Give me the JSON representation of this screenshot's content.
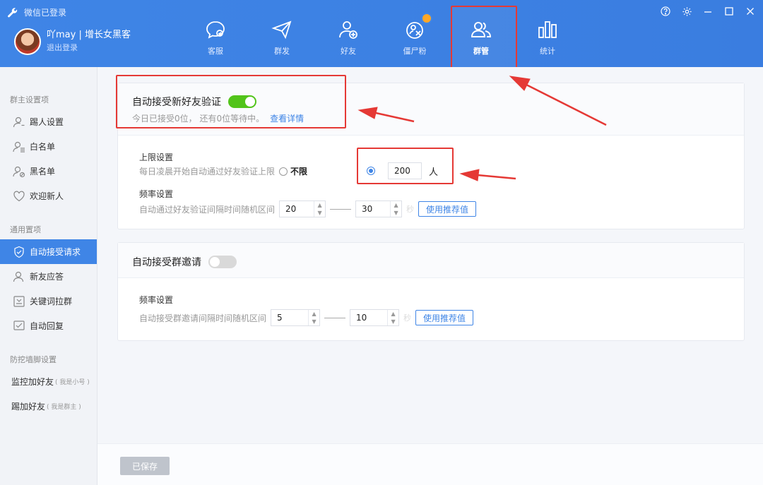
{
  "header": {
    "status": "微信已登录",
    "user_name": "吖may | 增长女黑客",
    "logout": "退出登录",
    "nav": [
      {
        "label": "客服",
        "icon": "chat-icon"
      },
      {
        "label": "群发",
        "icon": "send-icon"
      },
      {
        "label": "好友",
        "icon": "add-friend-icon"
      },
      {
        "label": "僵尸粉",
        "icon": "zombie-fan-icon"
      },
      {
        "label": "群管",
        "icon": "group-manage-icon"
      },
      {
        "label": "统计",
        "icon": "stats-icon"
      }
    ],
    "active_nav": "群管"
  },
  "sidebar": {
    "section1": "群主设置项",
    "section1_items": [
      "踢人设置",
      "白名单",
      "黑名单",
      "欢迎新人"
    ],
    "section2": "通用置项",
    "section2_items": [
      "自动接受请求",
      "新友应答",
      "关键词拉群",
      "自动回复"
    ],
    "section3": "防挖墙脚设置",
    "section3_items": [
      {
        "label": "监控加好友",
        "note": "( 我是小号 )"
      },
      {
        "label": "踢加好友",
        "note": "( 我是群主 )"
      }
    ]
  },
  "friend_card": {
    "title": "自动接受新好友验证",
    "toggle": "on",
    "subtitle": "今日已接受0位， 还有0位等待中。",
    "detail_link": "查看详情",
    "limit_label": "上限设置",
    "limit_desc": "每日凌晨开始自动通过好友验证上限",
    "unlimited": "不限",
    "limit_value": "200",
    "limit_unit": "人",
    "freq_label": "频率设置",
    "freq_desc": "自动通过好友验证间隔时间随机区间",
    "freq_min": "20",
    "freq_max": "30",
    "freq_unit": "秒",
    "recommend_btn": "使用推荐值"
  },
  "group_card": {
    "title": "自动接受群邀请",
    "toggle": "off",
    "freq_label": "频率设置",
    "freq_desc": "自动接受群邀请间隔时间随机区间",
    "freq_min": "5",
    "freq_max": "10",
    "freq_unit": "秒",
    "recommend_btn": "使用推荐值"
  },
  "footer": {
    "saved_btn": "已保存"
  },
  "colors": {
    "header_blue": "#3f85e6",
    "toggle_on": "#52c41a",
    "highlight_red": "#e53935"
  }
}
